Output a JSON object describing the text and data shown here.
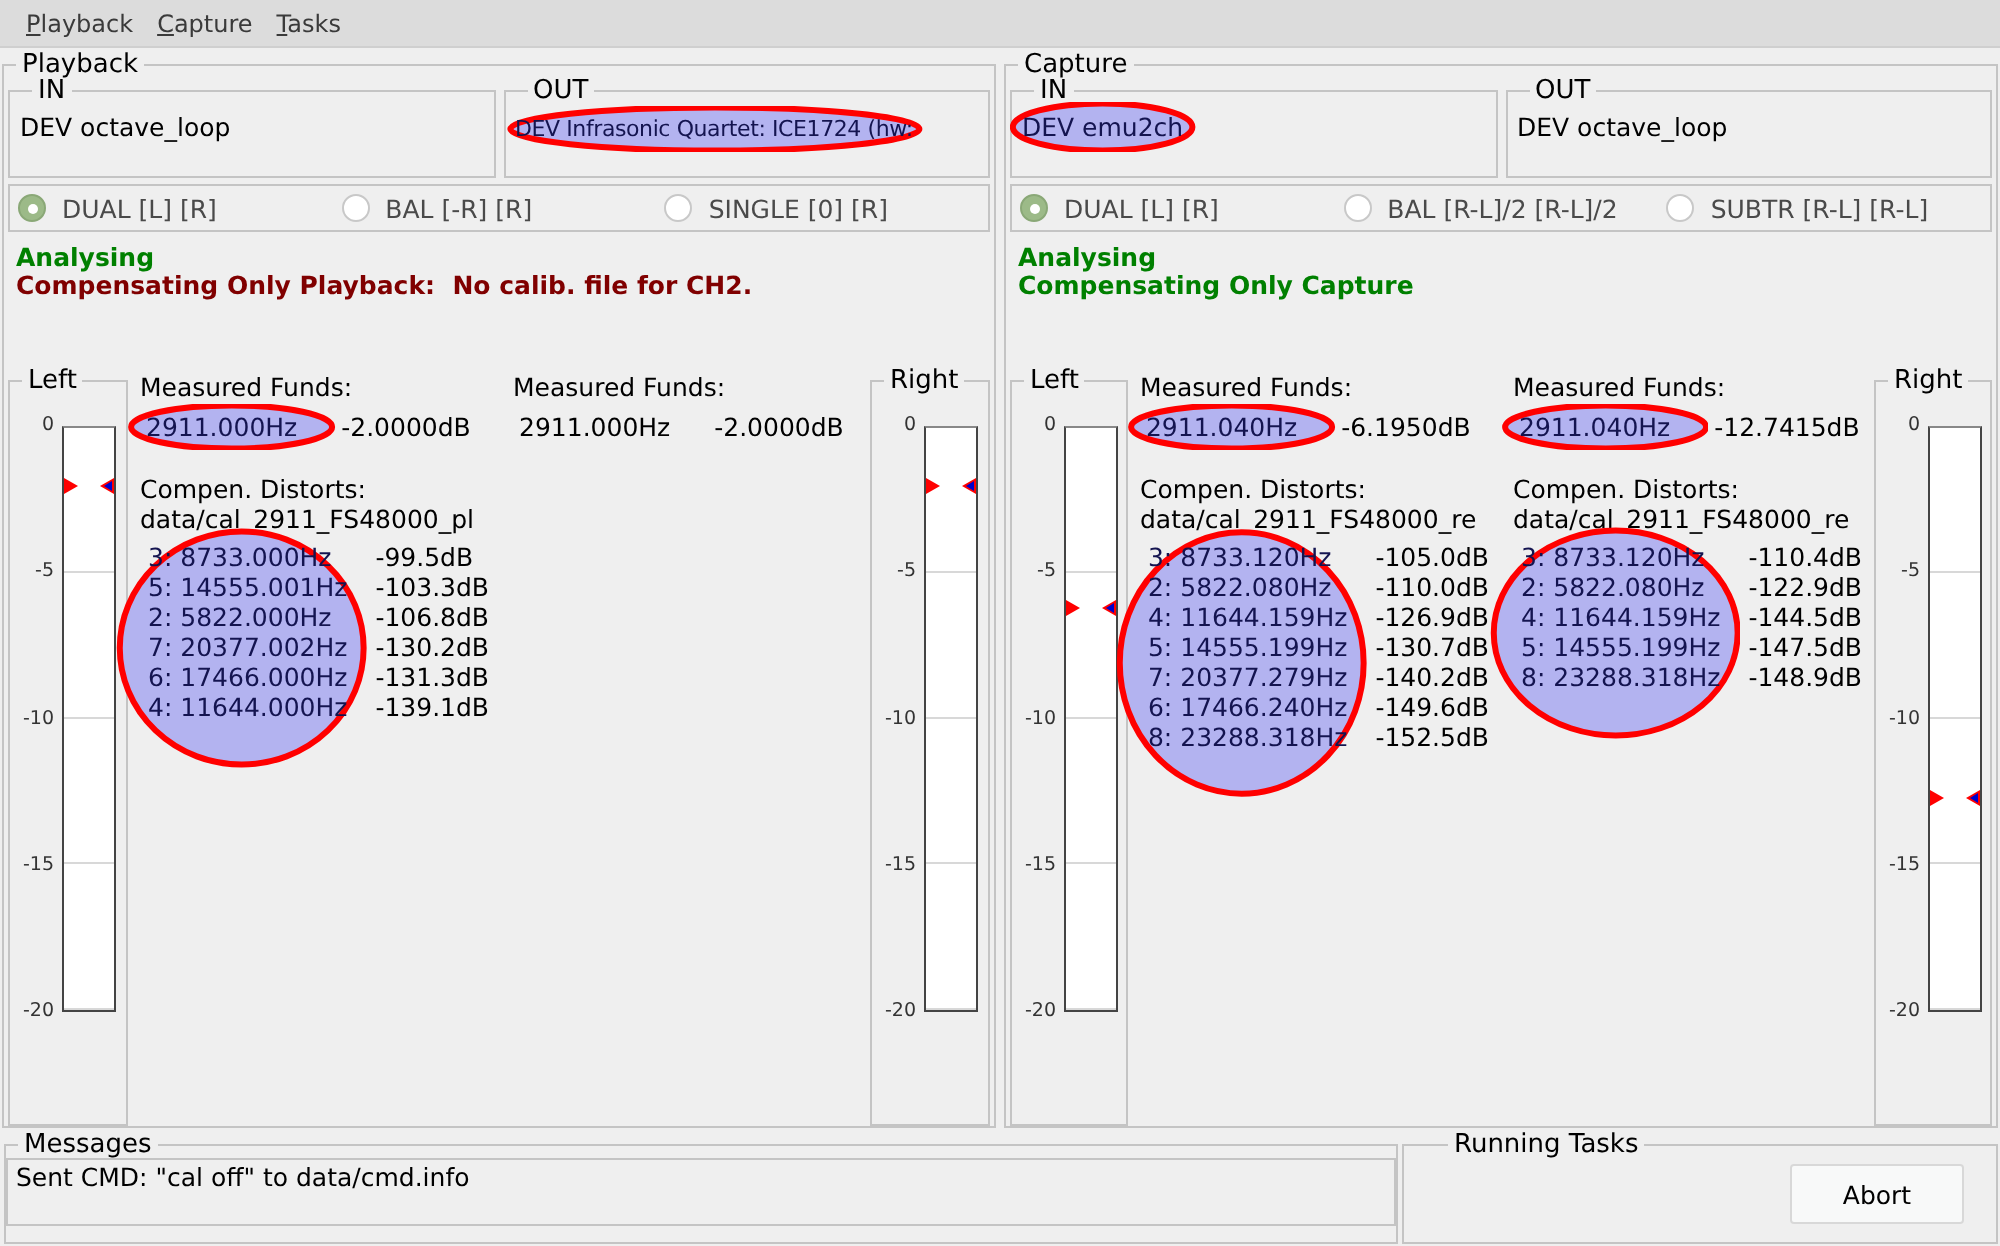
{
  "menu": [
    {
      "label": "Playback"
    },
    {
      "label": "Capture"
    },
    {
      "label": "Tasks"
    }
  ],
  "panels": [
    {
      "title": "Playback",
      "devices": [
        {
          "label": "IN",
          "value": "DEV octave_loop",
          "highlighted": false
        },
        {
          "label": "OUT",
          "value": "DEV Infrasonic Quartet: ICE1724 (hw:",
          "highlighted": true
        }
      ],
      "modes": [
        {
          "label": "DUAL [L] [R]",
          "selected": true
        },
        {
          "label": "BAL [-R] [R]",
          "selected": false
        },
        {
          "label": "SINGLE [0] [R]",
          "selected": false
        }
      ],
      "status": [
        {
          "text": "Analysing",
          "color": "#008000"
        },
        {
          "text": "Compensating Only Playback:  No calib. file for CH2.",
          "color": "#800000"
        }
      ],
      "meters": [
        {
          "label": "Left",
          "ticks": [
            "0",
            "-5",
            "-10",
            "-15",
            "-20"
          ],
          "level": 0.9
        },
        {
          "label": "Right",
          "ticks": [
            "0",
            "-5",
            "-10",
            "-15",
            "-20"
          ],
          "level": 0.9
        }
      ],
      "channels": [
        {
          "heading": "Measured Funds:",
          "frequency": "2911.000Hz",
          "gain": "-2.0000dB",
          "highlighted": true,
          "distortion": {
            "heading": "Compen. Distorts:",
            "file": "data/cal_2911_FS48000_pl",
            "highlighted": true,
            "rows": [
              {
                "frequency": "3: 8733.000Hz",
                "gain": "-99.5dB"
              },
              {
                "frequency": "5: 14555.001Hz",
                "gain": "-103.3dB"
              },
              {
                "frequency": "2: 5822.000Hz",
                "gain": "-106.8dB"
              },
              {
                "frequency": "7: 20377.002Hz",
                "gain": "-130.2dB"
              },
              {
                "frequency": "6: 17466.000Hz",
                "gain": "-131.3dB"
              },
              {
                "frequency": "4: 11644.000Hz",
                "gain": "-139.1dB"
              }
            ]
          }
        },
        {
          "heading": "Measured Funds:",
          "frequency": "2911.000Hz",
          "gain": "-2.0000dB",
          "highlighted": false
        }
      ]
    },
    {
      "title": "Capture",
      "devices": [
        {
          "label": "IN",
          "value": "DEV emu2ch",
          "highlighted": true
        },
        {
          "label": "OUT",
          "value": "DEV octave_loop",
          "highlighted": false
        }
      ],
      "modes": [
        {
          "label": "DUAL [L] [R]",
          "selected": true
        },
        {
          "label": "BAL [R-L]/2 [R-L]/2",
          "selected": false
        },
        {
          "label": "SUBTR [R-L] [R-L]",
          "selected": false
        }
      ],
      "status": [
        {
          "text": "Analysing",
          "color": "#008000"
        },
        {
          "text": "Compensating Only Capture",
          "color": "#008000"
        }
      ],
      "meters": [
        {
          "label": "Left",
          "ticks": [
            "0",
            "-5",
            "-10",
            "-15",
            "-20"
          ],
          "level": 0.69
        },
        {
          "label": "Right",
          "ticks": [
            "0",
            "-5",
            "-10",
            "-15",
            "-20"
          ],
          "level": 0.365
        }
      ],
      "channels": [
        {
          "heading": "Measured Funds:",
          "frequency": "2911.040Hz",
          "gain": "-6.1950dB",
          "highlighted": true,
          "distortion": {
            "heading": "Compen. Distorts:",
            "file": "data/cal_2911_FS48000_re",
            "highlighted": true,
            "rows": [
              {
                "frequency": "3: 8733.120Hz",
                "gain": "-105.0dB"
              },
              {
                "frequency": "2: 5822.080Hz",
                "gain": "-110.0dB"
              },
              {
                "frequency": "4: 11644.159Hz",
                "gain": "-126.9dB"
              },
              {
                "frequency": "5: 14555.199Hz",
                "gain": "-130.7dB"
              },
              {
                "frequency": "7: 20377.279Hz",
                "gain": "-140.2dB"
              },
              {
                "frequency": "6: 17466.240Hz",
                "gain": "-149.6dB"
              },
              {
                "frequency": "8: 23288.318Hz",
                "gain": "-152.5dB"
              }
            ]
          }
        },
        {
          "heading": "Measured Funds:",
          "frequency": "2911.040Hz",
          "gain": "-12.7415dB",
          "highlighted": true,
          "distortion": {
            "heading": "Compen. Distorts:",
            "file": "data/cal_2911_FS48000_re",
            "highlighted": true,
            "rows": [
              {
                "frequency": "3: 8733.120Hz",
                "gain": "-110.4dB"
              },
              {
                "frequency": "2: 5822.080Hz",
                "gain": "-122.9dB"
              },
              {
                "frequency": "4: 11644.159Hz",
                "gain": "-144.5dB"
              },
              {
                "frequency": "5: 14555.199Hz",
                "gain": "-147.5dB"
              },
              {
                "frequency": "8: 23288.318Hz",
                "gain": "-148.9dB"
              }
            ]
          }
        }
      ]
    }
  ],
  "messages": {
    "title": "Messages",
    "lines": [
      "Sent CMD: \"cal off\" to data/cmd.info"
    ]
  },
  "tasks": {
    "title": "Running Tasks",
    "button": "Abort"
  }
}
